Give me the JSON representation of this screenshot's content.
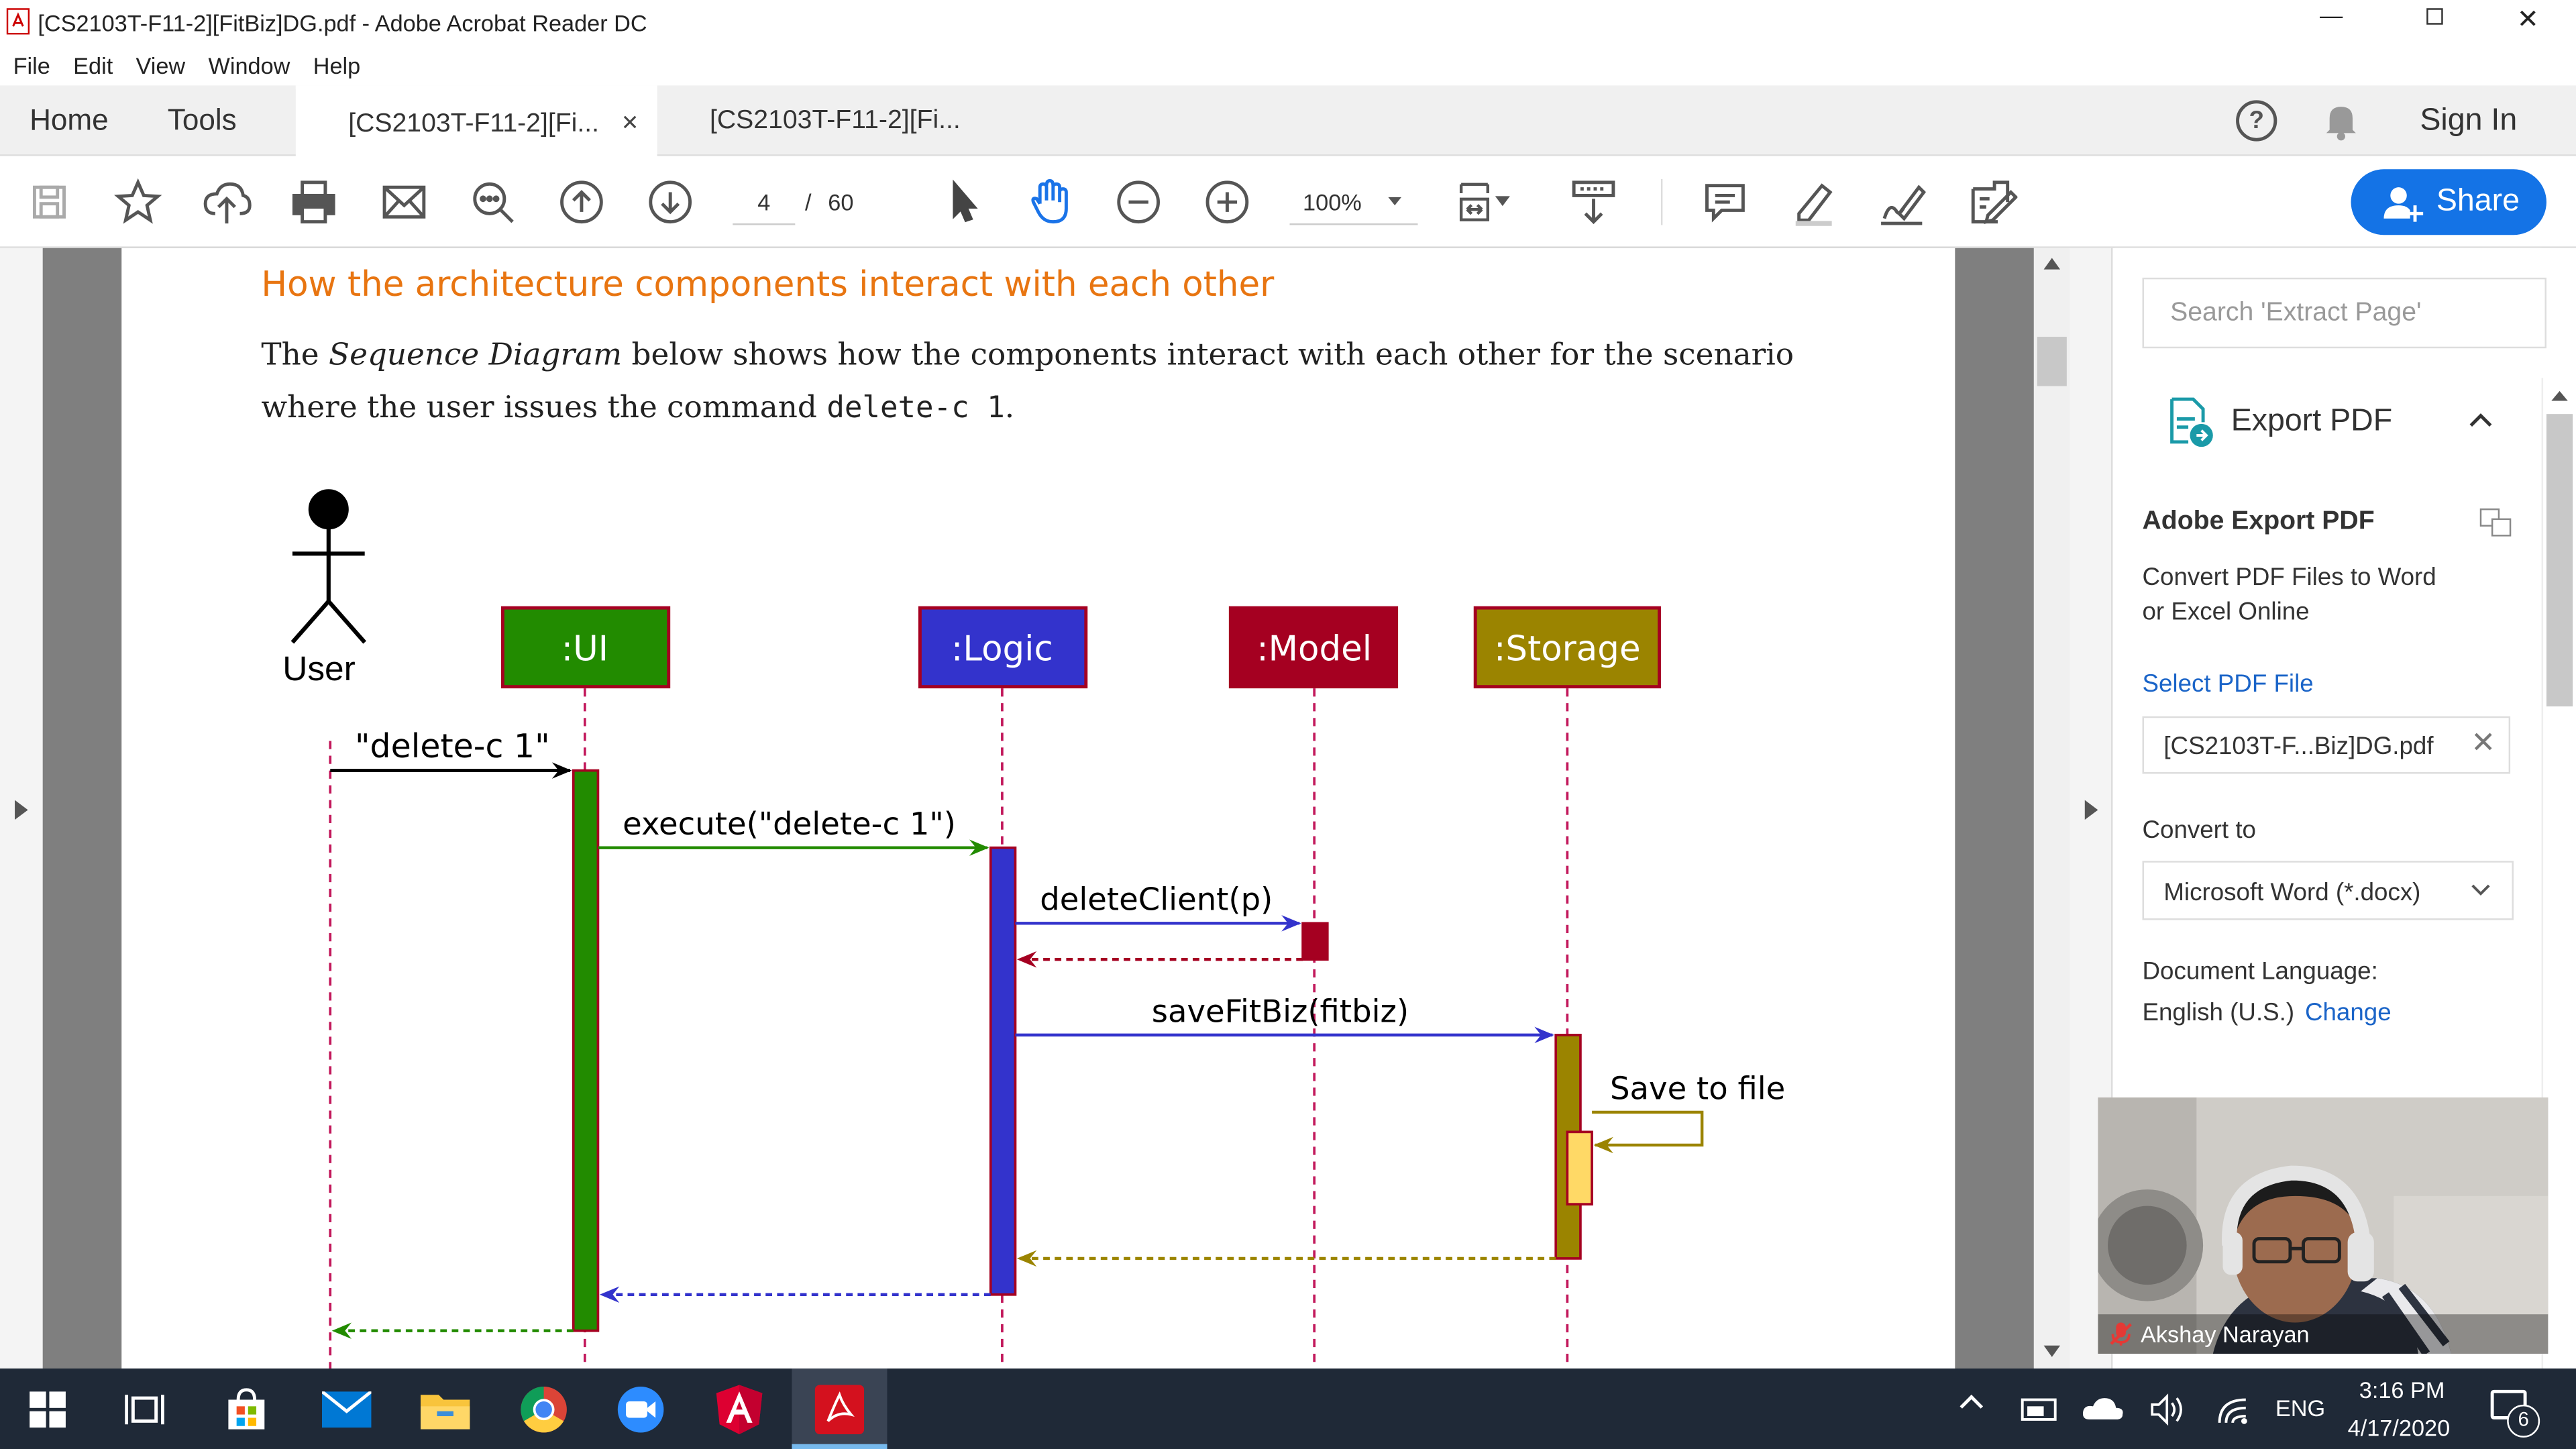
{
  "window": {
    "title": "[CS2103T-F11-2][FitBiz]DG.pdf - Adobe Acrobat Reader DC"
  },
  "menu": [
    "File",
    "Edit",
    "View",
    "Window",
    "Help"
  ],
  "tabs": {
    "home": "Home",
    "tools": "Tools",
    "doc1": "[CS2103T-F11-2][Fi...",
    "doc2": "[CS2103T-F11-2][Fi...",
    "signin": "Sign In"
  },
  "toolbar": {
    "page_current": "4",
    "page_sep": "/",
    "page_total": "60",
    "zoom": "100%",
    "share": "Share"
  },
  "doc": {
    "heading": "How the architecture components interact with each other",
    "para_pre": "The ",
    "para_em": "Sequence Diagram",
    "para_mid": " below shows how the components interact with each other for the scenario",
    "para_line2": "where the user issues the command ",
    "para_code": "delete-c 1",
    "para_end": "."
  },
  "diagram": {
    "actor": "User",
    "participants": [
      {
        "label": ":UI",
        "color": "#228b00"
      },
      {
        "label": ":Logic",
        "color": "#3333cc"
      },
      {
        "label": ":Model",
        "color": "#a50021"
      },
      {
        "label": ":Storage",
        "color": "#9b8400"
      }
    ],
    "messages": {
      "m1": "\"delete-c 1\"",
      "m2": "execute(\"delete-c 1\")",
      "m3": "deleteClient(p)",
      "m4": "saveFitBiz(fitbiz)",
      "m5": "Save to file"
    }
  },
  "panel": {
    "search_placeholder": "Search 'Extract Page'",
    "export_title": "Export PDF",
    "adobe_export": "Adobe Export PDF",
    "desc1": "Convert PDF Files to Word",
    "desc2": "or Excel Online",
    "select_link": "Select PDF File",
    "file_name": "[CS2103T-F...Biz]DG.pdf",
    "convert_label": "Convert to",
    "convert_value": "Microsoft Word (*.docx)",
    "lang_label": "Document Language:",
    "lang_value": "English (U.S.)",
    "lang_change": "Change"
  },
  "video": {
    "name": "Akshay Narayan"
  },
  "taskbar": {
    "lang": "ENG",
    "time": "3:16 PM",
    "date": "4/17/2020",
    "notif": "6"
  }
}
